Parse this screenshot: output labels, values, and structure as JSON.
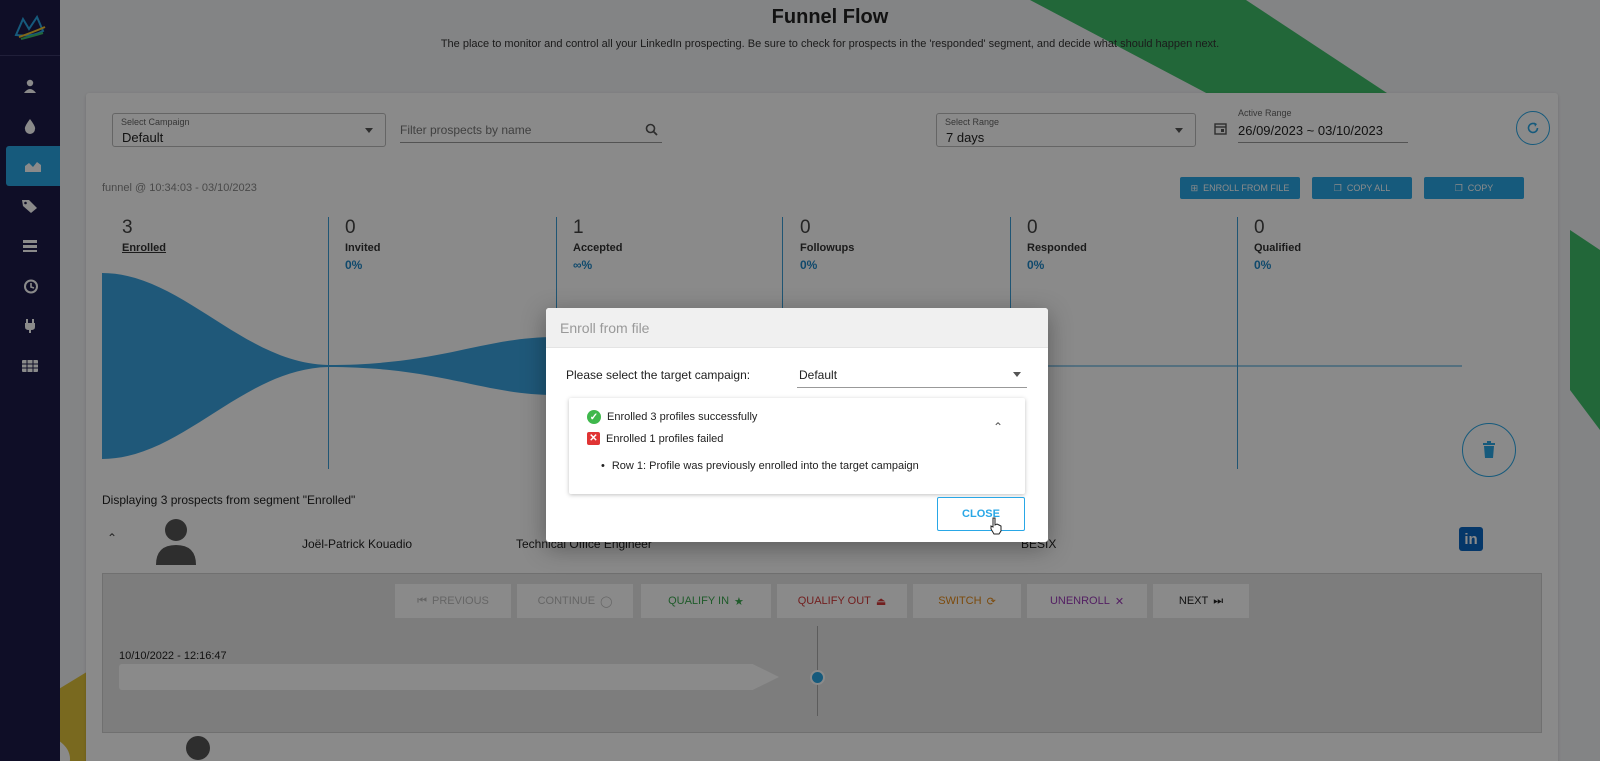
{
  "colors": {
    "accent": "#29a7e6",
    "sidebar": "#1c1b48",
    "success": "#3fb84c",
    "error": "#e03434",
    "qualify_in": "#3aa84f",
    "qualify_out": "#d23a3a",
    "switch": "#e58a16",
    "unenroll": "#9b3cb7"
  },
  "sidebar": {
    "logo": "bird-logo-icon",
    "items": [
      {
        "icon": "person-icon",
        "active": false
      },
      {
        "icon": "drop-icon",
        "active": false
      },
      {
        "icon": "funnel-chart-icon",
        "active": true
      },
      {
        "icon": "tags-icon",
        "active": false
      },
      {
        "icon": "inbox-icon",
        "active": false
      },
      {
        "icon": "history-icon",
        "active": false
      },
      {
        "icon": "plug-icon",
        "active": false
      },
      {
        "icon": "table-icon",
        "active": false
      }
    ]
  },
  "header": {
    "title": "Funnel Flow",
    "subtitle": "The place to monitor and control all your LinkedIn prospecting. Be sure to check for prospects in the 'responded' segment, and decide what should happen next."
  },
  "filters": {
    "campaign_label": "Select Campaign",
    "campaign_value": "Default",
    "search_placeholder": "Filter prospects by name",
    "range_label": "Select Range",
    "range_value": "7 days",
    "active_range_label": "Active Range",
    "active_range_value": "26/09/2023 ~ 03/10/2023"
  },
  "funnel": {
    "meta": "funnel @ 10:34:03 - 03/10/2023",
    "buttons": {
      "enroll": "Enroll from file",
      "copy_all": "Copy all",
      "copy": "Copy"
    },
    "stages": [
      {
        "count": "3",
        "name": "Enrolled",
        "pct": ""
      },
      {
        "count": "0",
        "name": "Invited",
        "pct": "0%"
      },
      {
        "count": "1",
        "name": "Accepted",
        "pct": "∞%"
      },
      {
        "count": "0",
        "name": "Followups",
        "pct": "0%"
      },
      {
        "count": "0",
        "name": "Responded",
        "pct": "0%"
      },
      {
        "count": "0",
        "name": "Qualified",
        "pct": "0%"
      }
    ]
  },
  "prospects": {
    "display_text": "Displaying 3 prospects from segment \"Enrolled\"",
    "row": {
      "name": "Joël-Patrick Kouadio",
      "title": "Technical Office Engineer",
      "company": "BESIX"
    }
  },
  "actions": {
    "previous": "Previous",
    "continue": "Continue",
    "qualify_in": "Qualify In",
    "qualify_out": "Qualify Out",
    "switch": "Switch",
    "unenroll": "Unenroll",
    "next": "Next"
  },
  "timeline": {
    "timestamp": "10/10/2022 - 12:16:47"
  },
  "dialog": {
    "title": "Enroll from file",
    "target_label": "Please select the target campaign:",
    "target_value": "Default",
    "success_text": "Enrolled 3 profiles successfully",
    "fail_text": "Enrolled 1 profiles failed",
    "error_detail": "Row 1: Profile was previously enrolled into the target campaign",
    "close_label": "Close"
  }
}
